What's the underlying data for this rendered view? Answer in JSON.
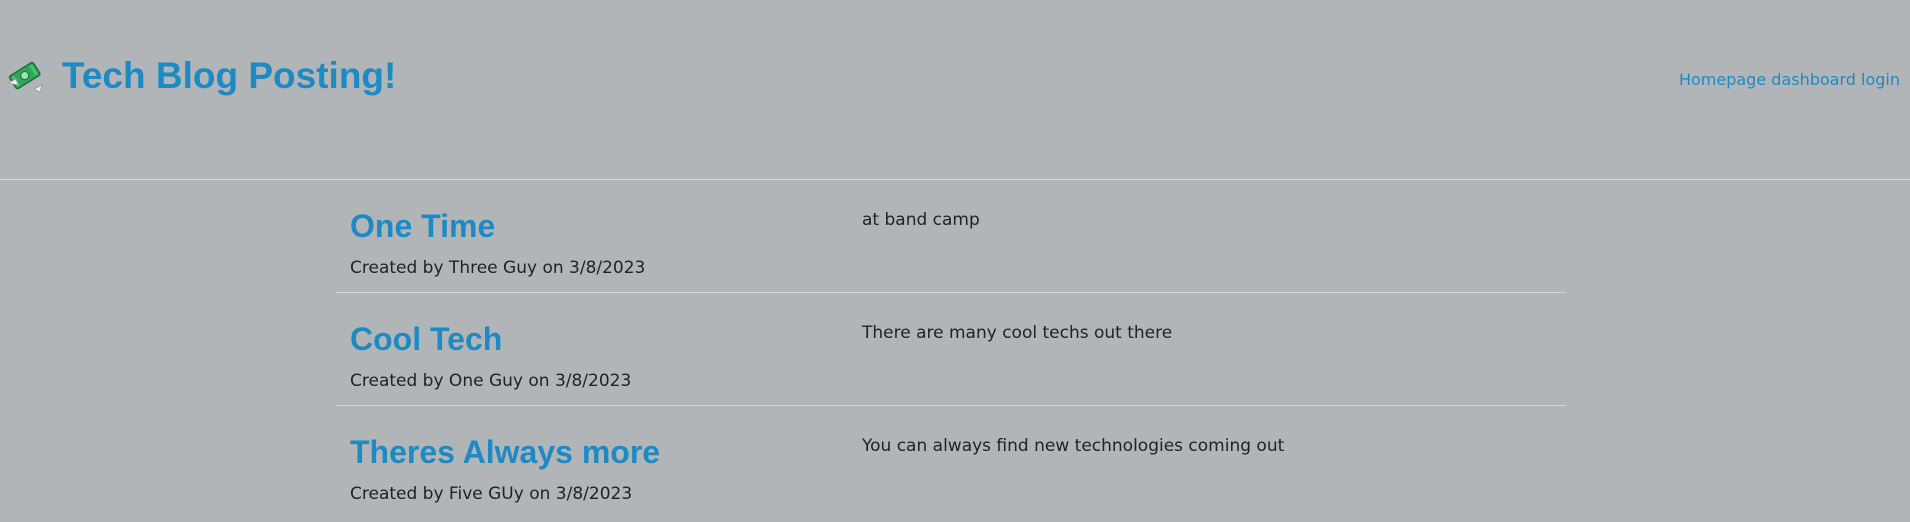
{
  "header": {
    "title": "Tech Blog Posting!",
    "icon": "money-with-wings-icon",
    "nav": {
      "homepage": "Homepage",
      "dashboard": "dashboard",
      "login": "login"
    }
  },
  "colors": {
    "background": "#b1b5b8",
    "accent": "#1d8ac3",
    "divider": "#d4d7d9",
    "text": "#222222"
  },
  "posts": [
    {
      "title": "One Time",
      "meta": "Created by Three Guy on 3/8/2023",
      "body": "at band camp"
    },
    {
      "title": "Cool Tech",
      "meta": "Created by One Guy on 3/8/2023",
      "body": "There are many cool techs out there"
    },
    {
      "title": "Theres Always more",
      "meta": "Created by Five GUy on 3/8/2023",
      "body": "You can always find new technologies coming out"
    }
  ]
}
